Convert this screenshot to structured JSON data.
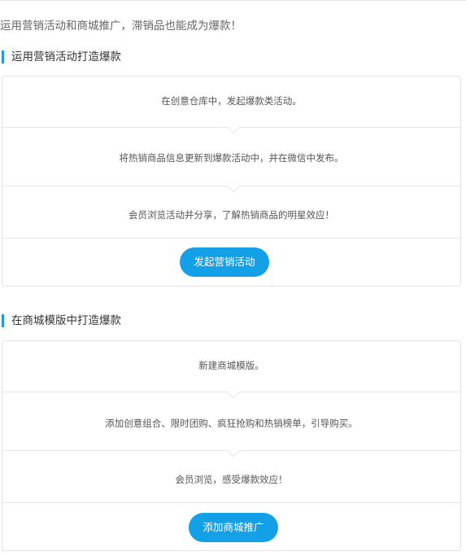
{
  "intro": "运用营销活动和商城推广，滞销品也能成为爆款！",
  "sections": [
    {
      "title": "运用营销活动打造爆款",
      "steps": [
        "在创意仓库中，发起爆款类活动。",
        "将热销商品信息更新到爆款活动中，并在微信中发布。",
        "会员浏览活动并分享，了解热销商品的明星效应！"
      ],
      "button": "发起营销活动"
    },
    {
      "title": "在商城模版中打造爆款",
      "steps": [
        "新建商城模版。",
        "添加创意组合、限时团购、疯狂抢购和热销榜单，引导购买。",
        "会员浏览，感受爆款效应！"
      ],
      "button": "添加商城推广"
    }
  ],
  "colors": {
    "accent": "#14a0e6",
    "title_bar": "#1a9de0",
    "border": "#e2e2e2"
  }
}
